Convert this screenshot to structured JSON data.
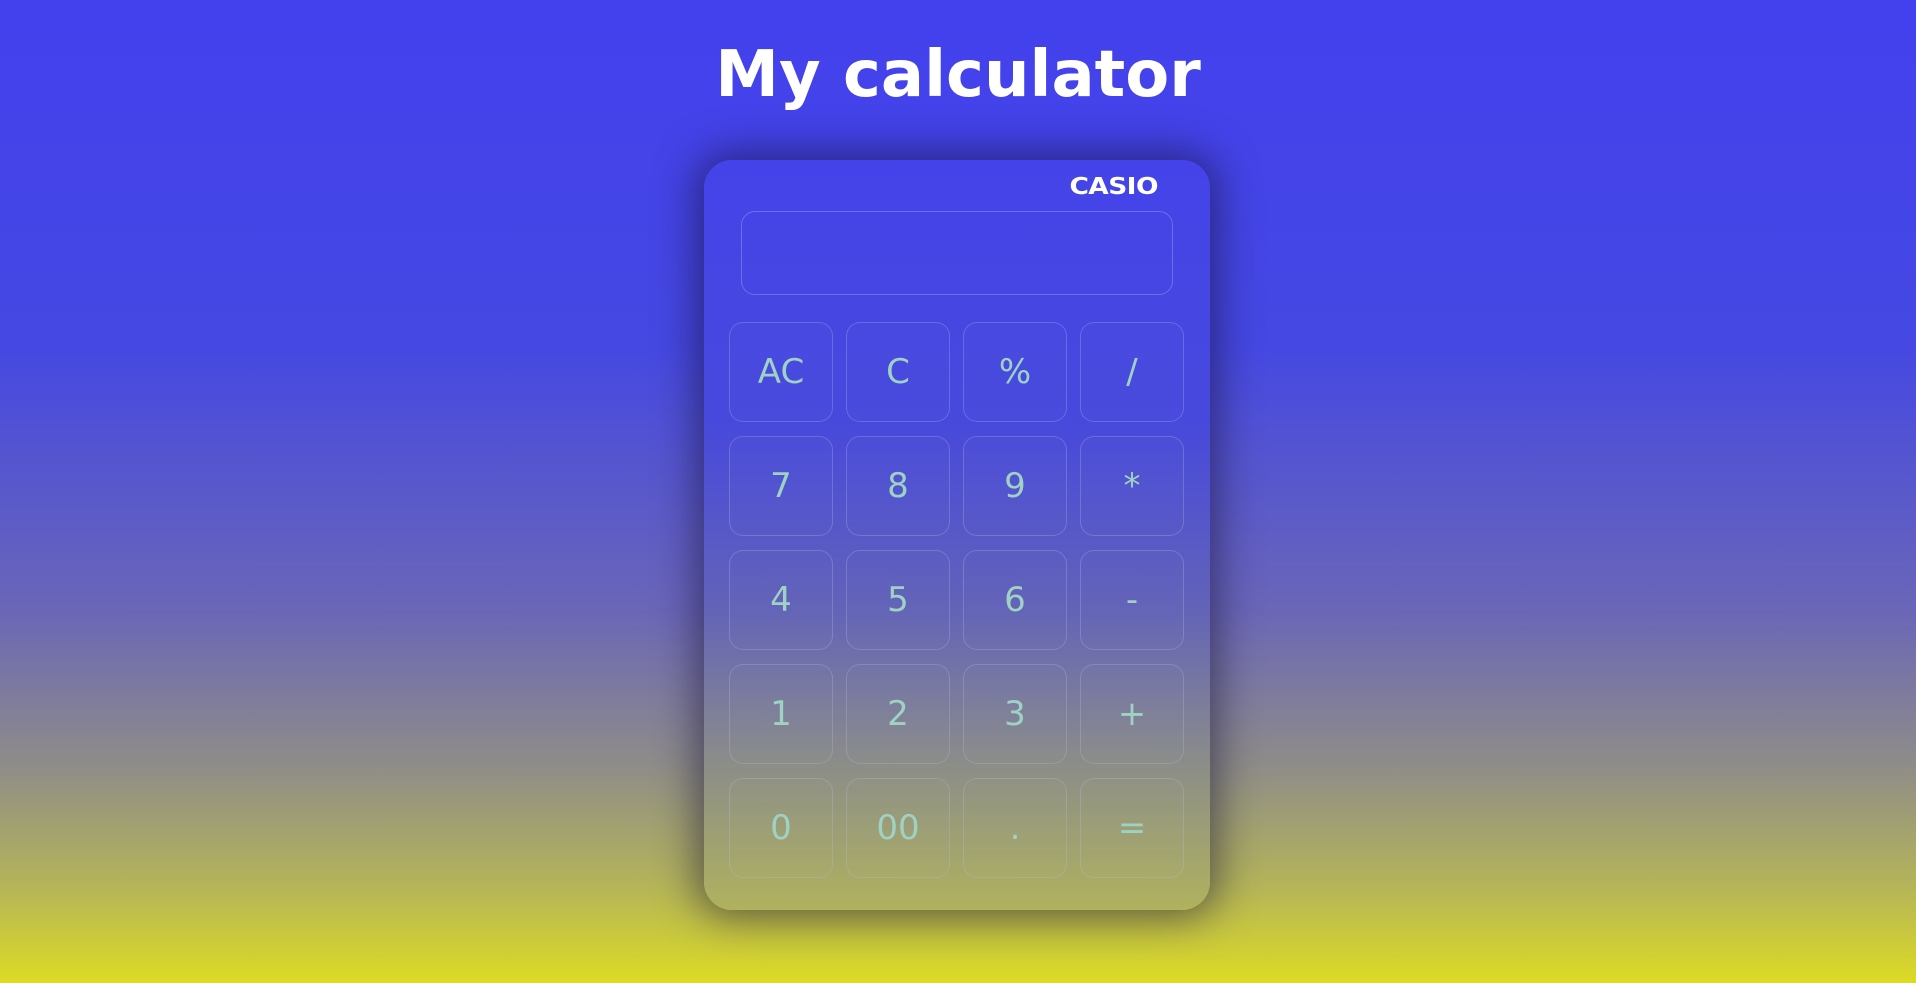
{
  "page": {
    "title": "My calculator"
  },
  "calculator": {
    "brand": "CASIO",
    "display_value": "",
    "keys": [
      {
        "label": "AC",
        "name": "all-clear-button"
      },
      {
        "label": "C",
        "name": "clear-button"
      },
      {
        "label": "%",
        "name": "percent-button"
      },
      {
        "label": "/",
        "name": "divide-button"
      },
      {
        "label": "7",
        "name": "digit-7-button"
      },
      {
        "label": "8",
        "name": "digit-8-button"
      },
      {
        "label": "9",
        "name": "digit-9-button"
      },
      {
        "label": "*",
        "name": "multiply-button"
      },
      {
        "label": "4",
        "name": "digit-4-button"
      },
      {
        "label": "5",
        "name": "digit-5-button"
      },
      {
        "label": "6",
        "name": "digit-6-button"
      },
      {
        "label": "-",
        "name": "subtract-button"
      },
      {
        "label": "1",
        "name": "digit-1-button"
      },
      {
        "label": "2",
        "name": "digit-2-button"
      },
      {
        "label": "3",
        "name": "digit-3-button"
      },
      {
        "label": "+",
        "name": "add-button"
      },
      {
        "label": "0",
        "name": "digit-0-button"
      },
      {
        "label": "00",
        "name": "double-zero-button"
      },
      {
        "label": ".",
        "name": "decimal-point-button"
      },
      {
        "label": "=",
        "name": "equals-button"
      }
    ]
  },
  "colors": {
    "background_top": "#4340ee",
    "background_bottom": "#dcdb24",
    "key_text": "#9fd2c2",
    "title_text": "#ffffff"
  }
}
